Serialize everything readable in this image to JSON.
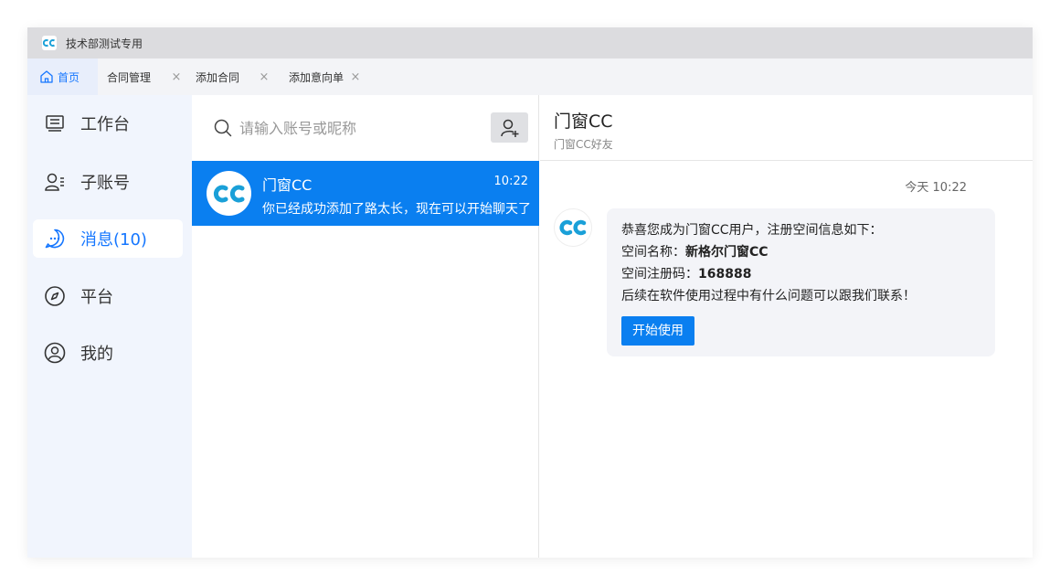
{
  "app": {
    "title": "技术部测试专用",
    "logo_text": "CC",
    "accent": "#1677ff"
  },
  "tabs": [
    {
      "label": "首页"
    },
    {
      "label": "合同管理"
    },
    {
      "label": "添加合同"
    },
    {
      "label": "添加意向单"
    }
  ],
  "sidebar": {
    "items": [
      {
        "label": "工作台",
        "icon": "workbench-icon"
      },
      {
        "label": "子账号",
        "icon": "sub-account-icon"
      },
      {
        "label": "消息(10)",
        "icon": "message-icon"
      },
      {
        "label": "平台",
        "icon": "compass-icon"
      },
      {
        "label": "我的",
        "icon": "user-icon"
      }
    ]
  },
  "search": {
    "placeholder": "请输入账号或昵称",
    "value": ""
  },
  "conversations": [
    {
      "name": "门窗CC",
      "time": "10:22",
      "preview": "你已经成功添加了路太长，现在可以开始聊天了"
    }
  ],
  "chat": {
    "title": "门窗CC",
    "subtitle": "门窗CC好友",
    "timestamp": "今天 10:22",
    "message": {
      "line1": "恭喜您成为门窗CC用户，注册空间信息如下：",
      "space_name_label": "空间名称：",
      "space_name": "新格尔门窗CC",
      "space_code_label": "空间注册码：",
      "space_code": "168888",
      "line4": "后续在软件使用过程中有什么问题可以跟我们联系！",
      "button": "开始使用"
    }
  }
}
